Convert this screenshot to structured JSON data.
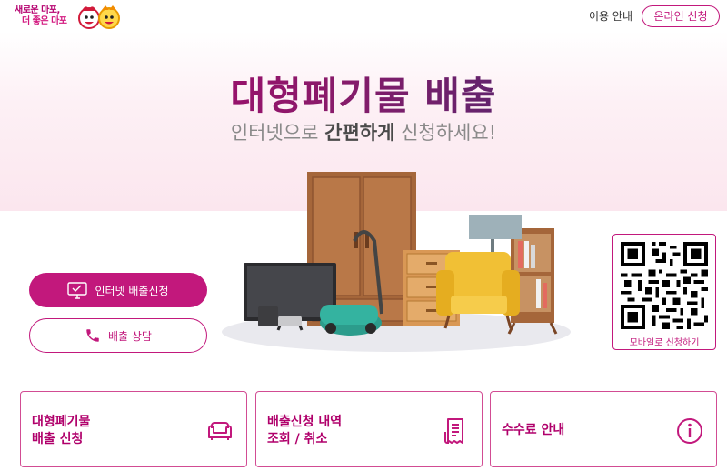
{
  "header": {
    "logo_line1": "새로운 마포,",
    "logo_line2": "더 좋은 마포",
    "guide_label": "이용 안내",
    "online_apply_label": "온라인 신청"
  },
  "hero": {
    "title": "대형폐기물 배출",
    "subtitle_pre": "인터넷으로 ",
    "subtitle_bold": "간편하게",
    "subtitle_post": " 신청하세요!"
  },
  "actions": {
    "internet_apply_label": "인터넷 배출신청",
    "consult_label": "배출 상담"
  },
  "qr": {
    "label": "모바일로 신청하기"
  },
  "cards": [
    {
      "line1": "대형폐기물",
      "line2": "배출 신청",
      "icon": "sofa-icon"
    },
    {
      "line1": "배출신청 내역",
      "line2": "조회 / 취소",
      "icon": "receipt-icon"
    },
    {
      "line1": "수수료 안내",
      "icon": "info-icon"
    }
  ],
  "colors": {
    "brand": "#c2187c",
    "brand_dark": "#b0006b",
    "title_gradient_end": "#2d2f6f",
    "hero_bg": "#fbe6ee"
  }
}
